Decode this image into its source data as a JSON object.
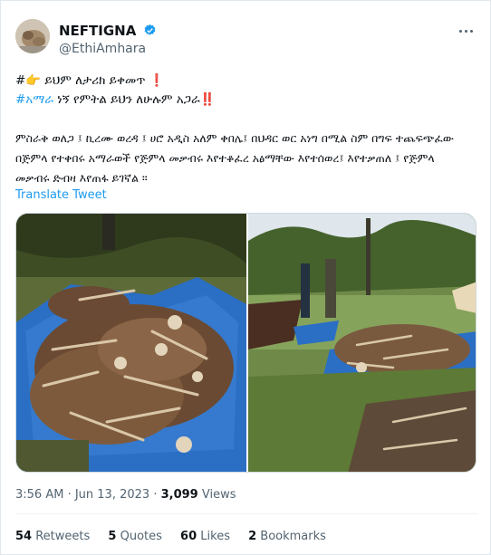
{
  "tweet": {
    "author": {
      "display_name": "NEFTIGNA",
      "handle": "@EthiAmhara",
      "verified": true,
      "avatar_icon": "profile-photo"
    },
    "lines": {
      "l1_hash": "#",
      "l1_text": " ይህም ለታሪክ ይቀመጥ ",
      "l1_bang": "❗",
      "l2_tag": "#አማራ",
      "l2_text": " ነኝ የምትል ይህን ለሁሉም አጋራ",
      "l2_bang": "‼️",
      "p1": "ምስራቅ ወለጋ ፤ ኪረሙ ወረዳ ፤ ሀሮ አዲስ አለም ቀበሌ፤ በህዳር ወር አነግ በሚል ስም በግፍ ተጨፍጭፈው",
      "p2": "በጅምላ የተቀበሩ  አማራወች የጅምላ መቃብሩ እየተቆፈረ አፅማቸው እየተሰወረ፤ እየተቃጠለ ፤ የጅምላ",
      "p3": "መቃብሩ ድብዛ እየጠፋ ይገኛል ።"
    },
    "translate_label": "Translate Tweet",
    "time": "3:56 AM",
    "separator": " · ",
    "date": "Jun 13, 2023",
    "views_count": "3,099",
    "views_label": " Views",
    "stats": {
      "retweets_count": "54",
      "retweets_label": " Retweets",
      "quotes_count": "5",
      "quotes_label": " Quotes",
      "likes_count": "60",
      "likes_label": " Likes",
      "bookmarks_count": "2",
      "bookmarks_label": " Bookmarks"
    },
    "colors": {
      "link": "#1d9bf0",
      "text": "#0f1419",
      "secondary": "#536471",
      "tarp": "#2a6fc4"
    }
  }
}
